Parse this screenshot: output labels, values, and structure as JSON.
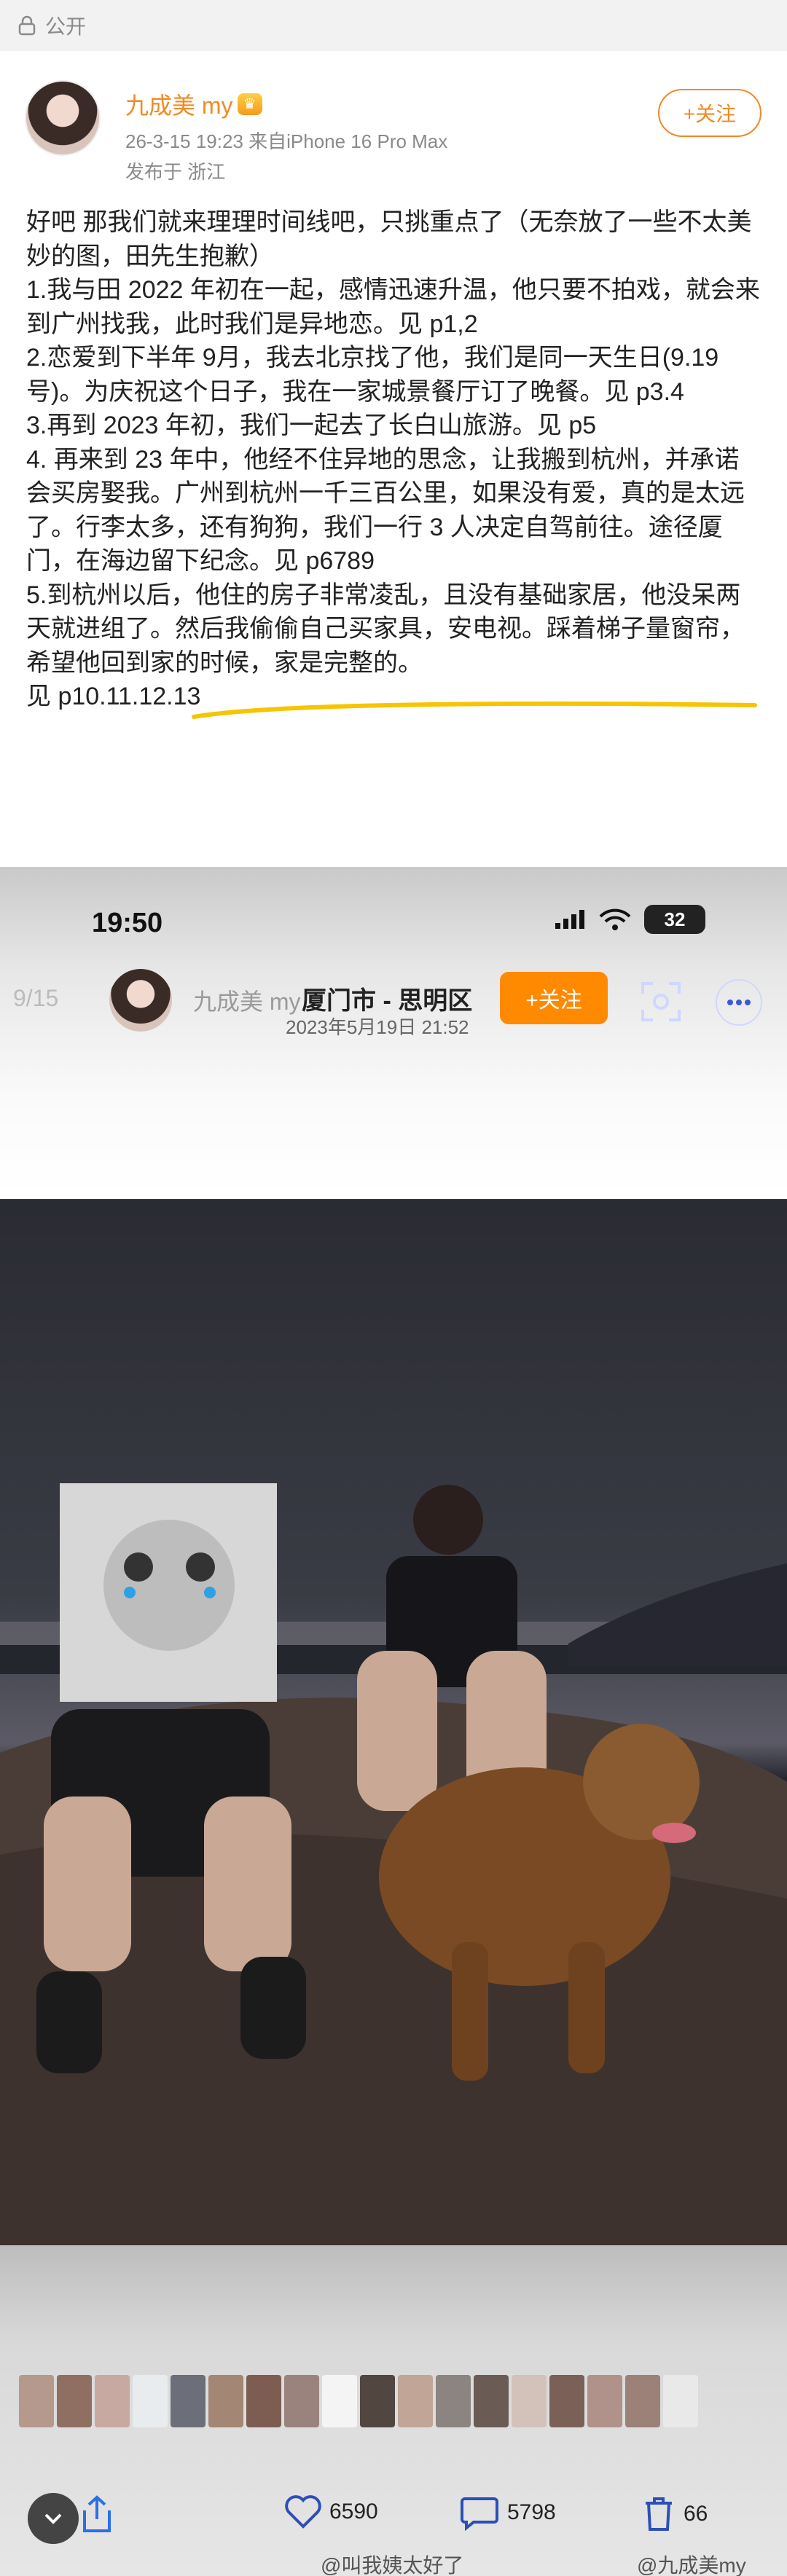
{
  "visibility": {
    "label": "公开"
  },
  "author": {
    "name": "九成美 my",
    "crown_glyph": "♛",
    "meta_line": "26-3-15 19:23  来自iPhone 16 Pro Max",
    "location_line": "发布于 浙江",
    "follow_label": "+关注"
  },
  "post": {
    "lines": [
      "好吧 那我们就来理理时间线吧，只挑重点了（无奈放了一些不太美妙的图，田先生抱歉）",
      "1.我与田 2022 年初在一起，感情迅速升温，他只要不拍戏，就会来到广州找我，此时我们是异地恋。见 p1,2",
      "2.恋爱到下半年 9月，我去北京找了他，我们是同一天生日(9.19号)。为庆祝这个日子，我在一家城景餐厅订了晚餐。见 p3.4",
      "3.再到 2023 年初，我们一起去了长白山旅游。见 p5",
      "4. 再来到 23 年中，他经不住异地的思念，让我搬到杭州，并承诺会买房娶我。广州到杭州一千三百公里，如果没有爱，真的是太远了。行李太多，还有狗狗，我们一行 3 人决定自驾前往。途径厦门，在海边留下纪念。见 p6789",
      "5.到杭州以后，他住的房子非常凌乱，且没有基础家居，他没呆两天就进组了。然后我偷偷自己买家具，安电视。踩着梯子量窗帘，希望他回到家的时候，家是完整的。",
      "见 p10.11.12.13"
    ]
  },
  "screenshot": {
    "status_time": "19:50",
    "battery": "32",
    "page_counter": "9/15",
    "name": "九成美 my",
    "location": "厦门市 - 思明区",
    "date": "2023年5月19日  21:52",
    "follow_label": "+关注",
    "like_count": "6590",
    "comment_count": "5798",
    "share_count": "66",
    "watermark_left": "@叫我姨太好了",
    "watermark_right": "@九成美my"
  },
  "colors": {
    "accent": "#f08a24",
    "follow_fill": "#ff8a00",
    "highlight_stroke": "#f6c400"
  },
  "icons": [
    "lock-icon",
    "crown-icon",
    "scan-icon",
    "more-icon",
    "heart-icon",
    "share-icon",
    "comment-icon",
    "menu-icon",
    "trash-icon"
  ]
}
